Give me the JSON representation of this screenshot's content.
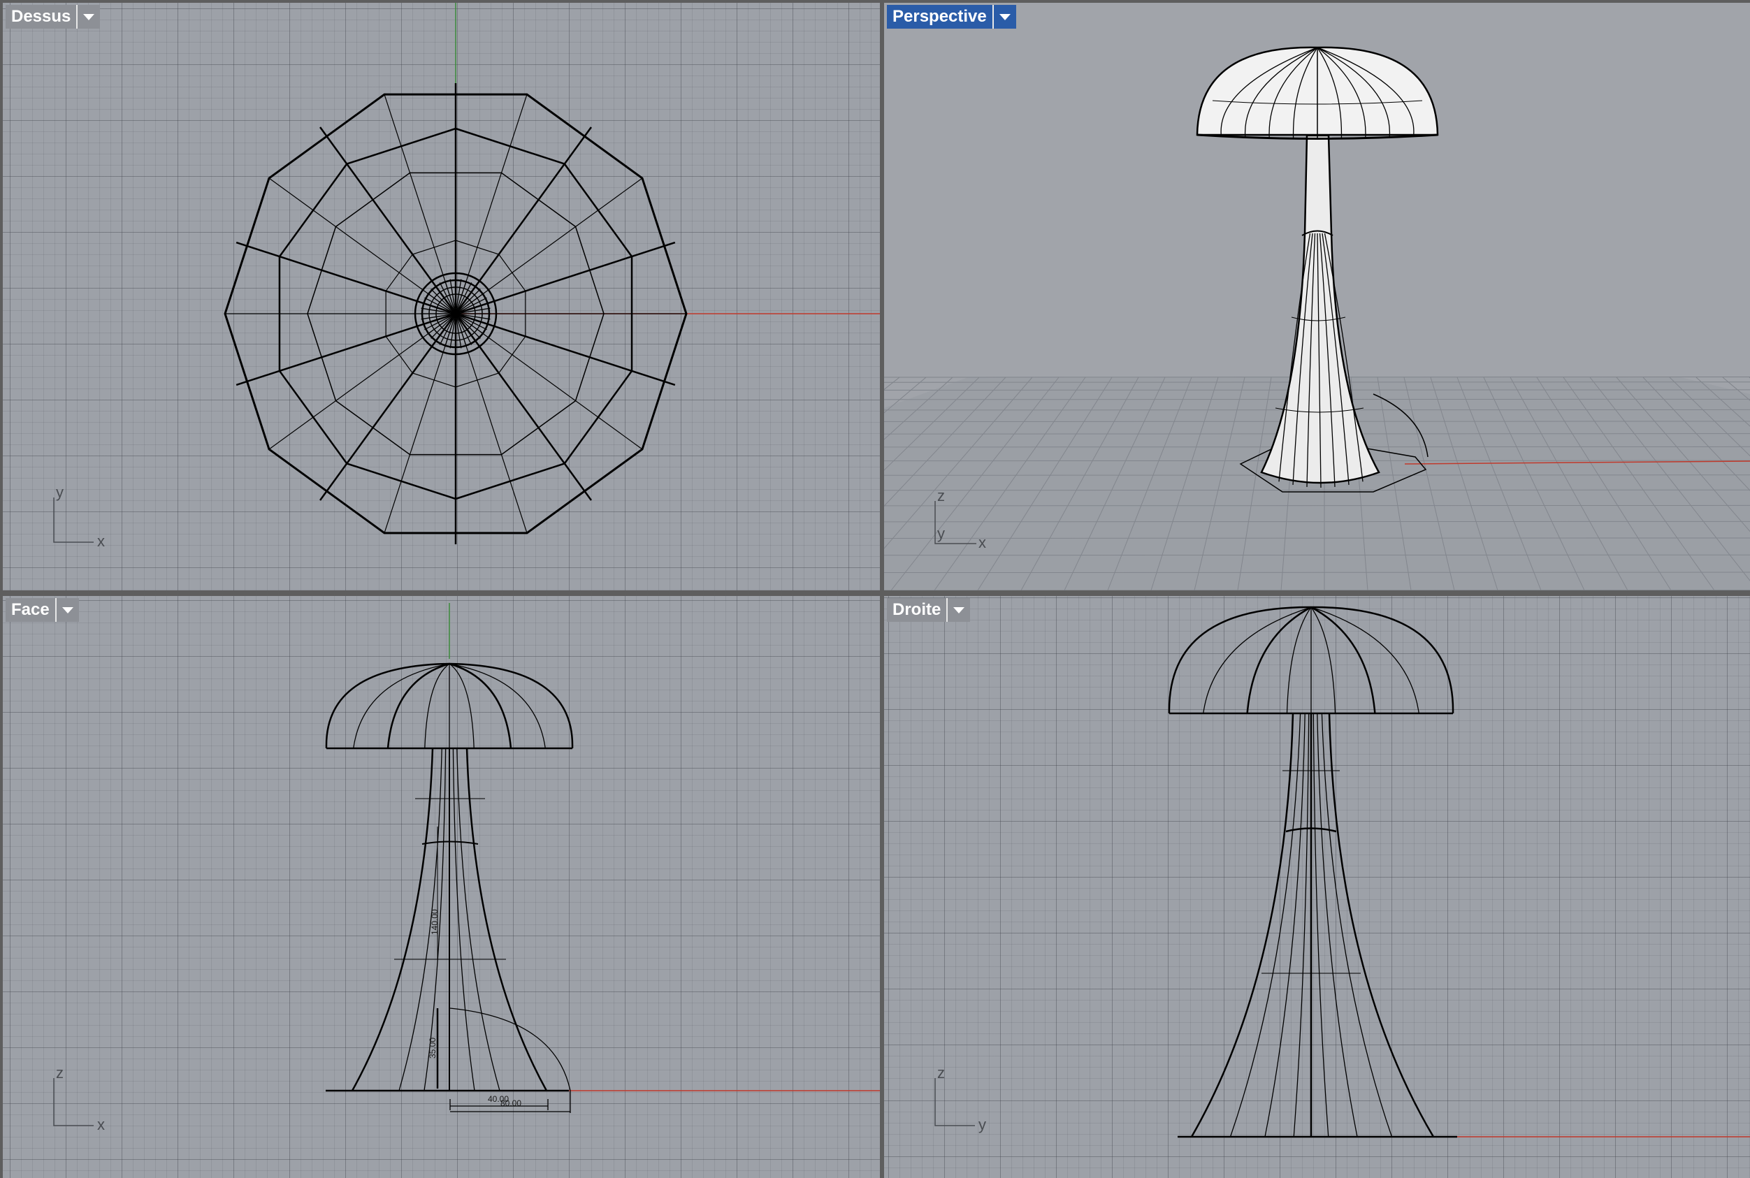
{
  "viewports": {
    "top": {
      "title": "Dessus",
      "axis_v": "y",
      "axis_h": "x"
    },
    "persp": {
      "title": "Perspective",
      "axis_v": "z",
      "axis_m": "y",
      "axis_h": "x"
    },
    "front": {
      "title": "Face",
      "axis_v": "z",
      "axis_h": "x"
    },
    "right": {
      "title": "Droite",
      "axis_v": "z",
      "axis_h": "y"
    }
  },
  "dimensions": {
    "height_top": "140.00",
    "height_bottom": "35.00",
    "width_inner": "40.00",
    "width_outer": "80.00"
  },
  "colors": {
    "viewport_bg": "#9da1a8",
    "active_tab": "#2a5ca8",
    "inactive_tab": "#8d9096",
    "x_axis": "#c0392b",
    "y_axis": "#3c8a3c",
    "wire": "#000000"
  }
}
